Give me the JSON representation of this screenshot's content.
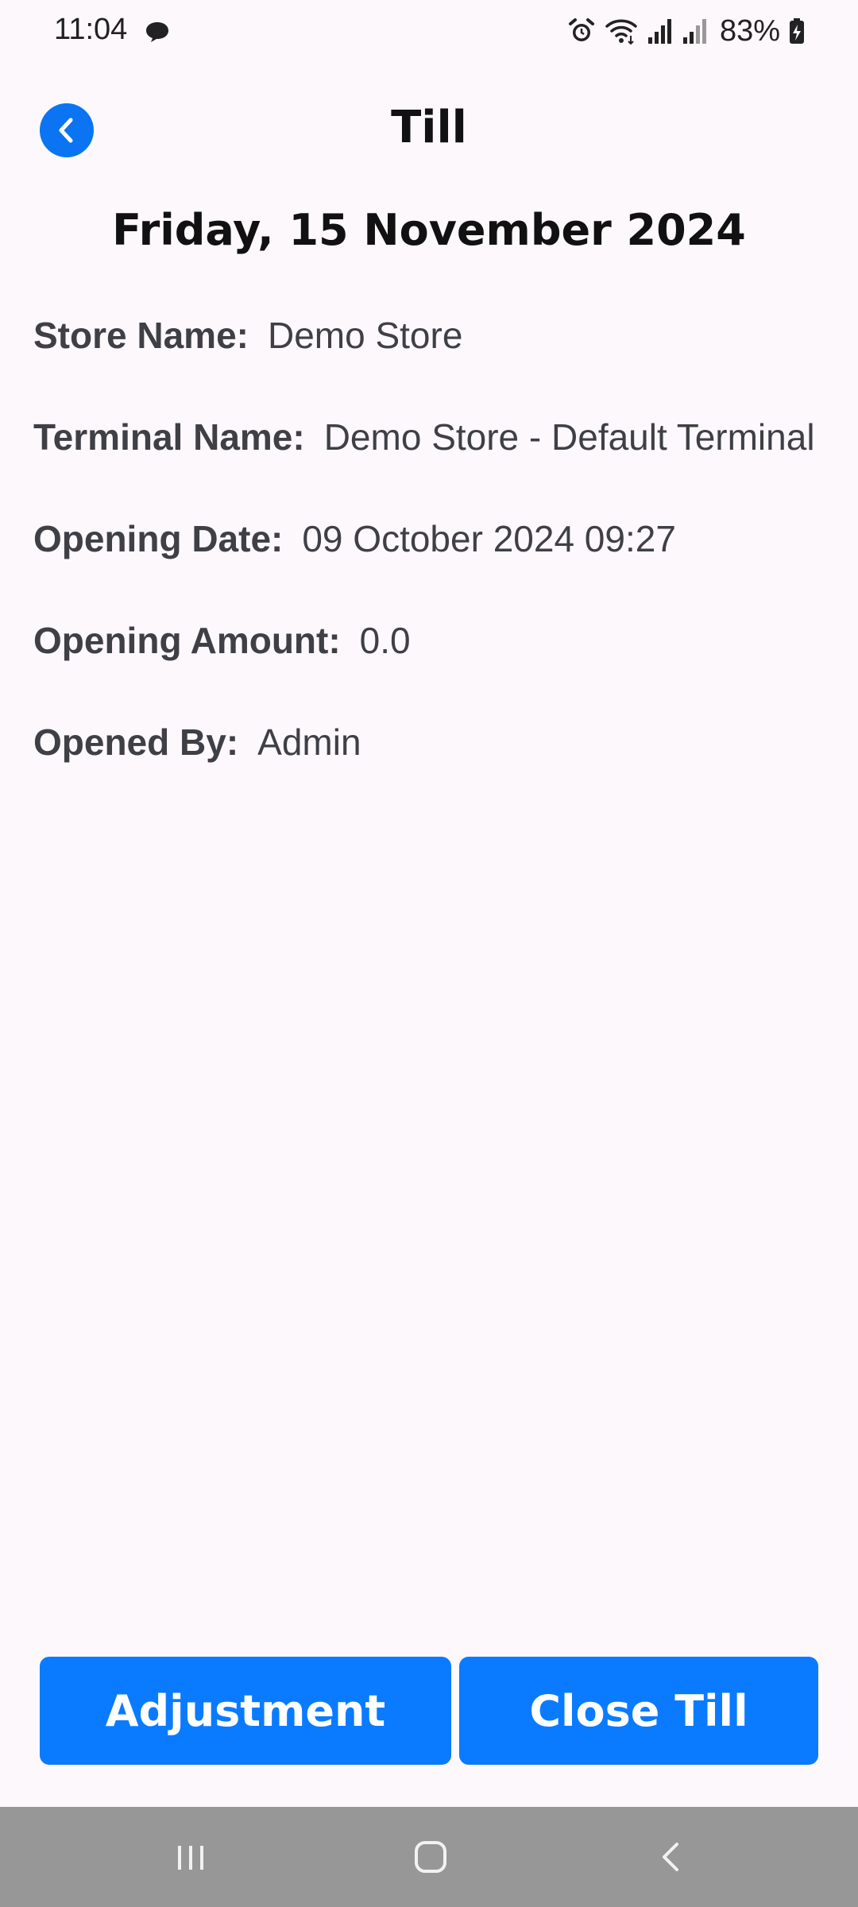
{
  "status_bar": {
    "time": "11:04",
    "battery": "83%",
    "icons": [
      "message-icon",
      "alarm-icon",
      "wifi-icon",
      "signal-icon",
      "signal-icon",
      "battery-charging-icon"
    ]
  },
  "header": {
    "title": "Till",
    "back_icon": "chevron-left-icon"
  },
  "date_heading": "Friday, 15 November 2024",
  "info": [
    {
      "label": "Store Name:",
      "value": "Demo Store"
    },
    {
      "label": "Terminal Name:",
      "value": "Demo Store - Default Terminal"
    },
    {
      "label": "Opening Date:",
      "value": "09 October 2024 09:27"
    },
    {
      "label": "Opening Amount:",
      "value": "0.0"
    },
    {
      "label": "Opened By:",
      "value": "Admin"
    }
  ],
  "buttons": {
    "adjustment": "Adjustment",
    "close_till": "Close Till"
  },
  "nav_bar": {
    "icons": [
      "recent-apps-icon",
      "home-icon",
      "back-icon"
    ]
  },
  "colors": {
    "accent": "#0a7bff",
    "background": "#fcf8fc",
    "nav_bar": "#979797",
    "label_text": "#3f3f46"
  }
}
